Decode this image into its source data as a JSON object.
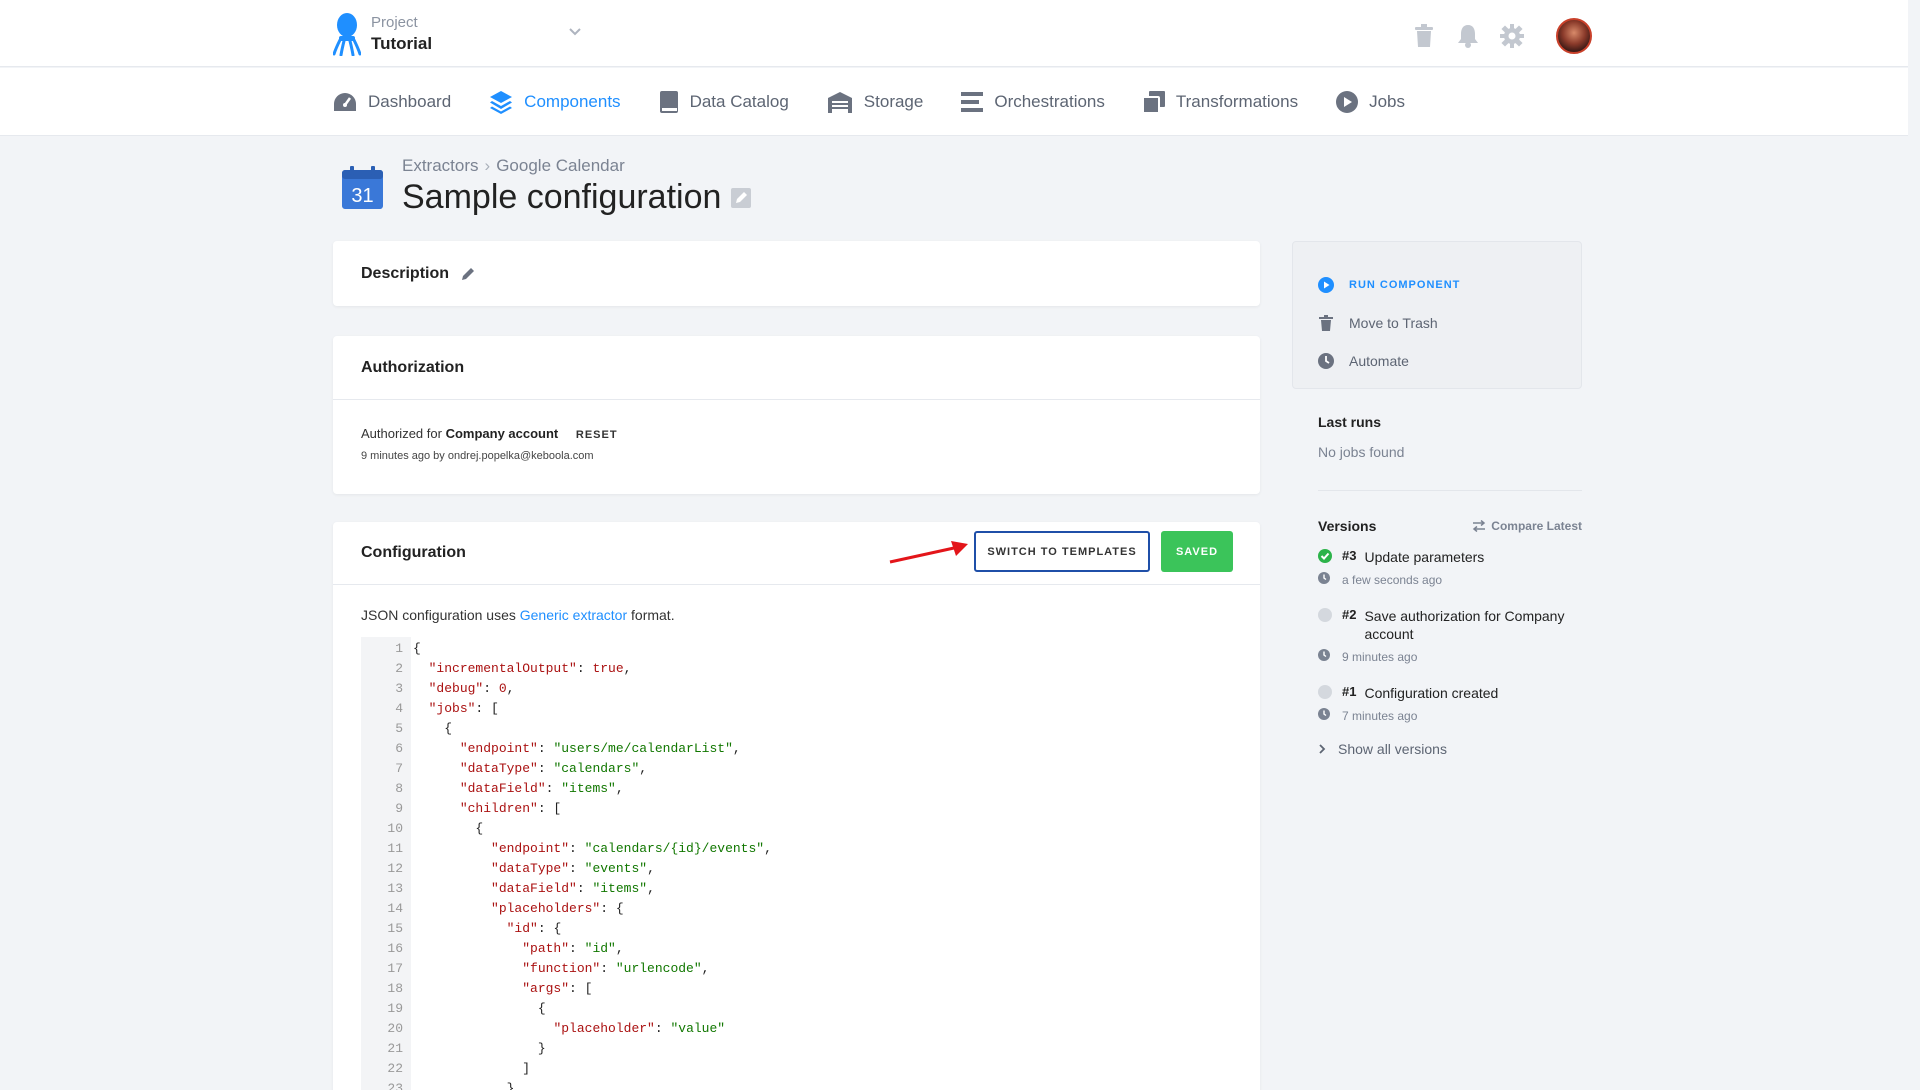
{
  "project": {
    "label": "Project",
    "name": "Tutorial"
  },
  "nav": [
    {
      "label": "Dashboard",
      "icon": "dashboard-icon",
      "active": false
    },
    {
      "label": "Components",
      "icon": "layers-icon",
      "active": true
    },
    {
      "label": "Data Catalog",
      "icon": "book-icon",
      "active": false
    },
    {
      "label": "Storage",
      "icon": "warehouse-icon",
      "active": false
    },
    {
      "label": "Orchestrations",
      "icon": "bars-icon",
      "active": false
    },
    {
      "label": "Transformations",
      "icon": "copy-icon",
      "active": false
    },
    {
      "label": "Jobs",
      "icon": "play-circle-icon",
      "active": false
    }
  ],
  "breadcrumb": {
    "parent": "Extractors",
    "separator": "›",
    "current": "Google Calendar",
    "calendar_day": "31"
  },
  "title": "Sample configuration",
  "description": {
    "heading": "Description"
  },
  "authorization": {
    "heading": "Authorization",
    "prefix": "Authorized for",
    "account": "Company account",
    "reset_label": "RESET",
    "meta": "9 minutes ago by ondrej.popelka@keboola.com"
  },
  "configuration": {
    "heading": "Configuration",
    "switch_label": "SWITCH TO TEMPLATES",
    "saved_label": "SAVED",
    "note_prefix": "JSON configuration uses",
    "note_link": "Generic extractor",
    "note_suffix": "format."
  },
  "code_lines": [
    [
      {
        "t": "{",
        "c": ""
      }
    ],
    [
      {
        "t": "  ",
        "c": ""
      },
      {
        "t": "\"incrementalOutput\"",
        "c": "k"
      },
      {
        "t": ": ",
        "c": ""
      },
      {
        "t": "true",
        "c": "kw"
      },
      {
        "t": ",",
        "c": ""
      }
    ],
    [
      {
        "t": "  ",
        "c": ""
      },
      {
        "t": "\"debug\"",
        "c": "k"
      },
      {
        "t": ": ",
        "c": ""
      },
      {
        "t": "0",
        "c": "n"
      },
      {
        "t": ",",
        "c": ""
      }
    ],
    [
      {
        "t": "  ",
        "c": ""
      },
      {
        "t": "\"jobs\"",
        "c": "k"
      },
      {
        "t": ": [",
        "c": ""
      }
    ],
    [
      {
        "t": "    {",
        "c": ""
      }
    ],
    [
      {
        "t": "      ",
        "c": ""
      },
      {
        "t": "\"endpoint\"",
        "c": "k"
      },
      {
        "t": ": ",
        "c": ""
      },
      {
        "t": "\"users/me/calendarList\"",
        "c": "s"
      },
      {
        "t": ",",
        "c": ""
      }
    ],
    [
      {
        "t": "      ",
        "c": ""
      },
      {
        "t": "\"dataType\"",
        "c": "k"
      },
      {
        "t": ": ",
        "c": ""
      },
      {
        "t": "\"calendars\"",
        "c": "s"
      },
      {
        "t": ",",
        "c": ""
      }
    ],
    [
      {
        "t": "      ",
        "c": ""
      },
      {
        "t": "\"dataField\"",
        "c": "k"
      },
      {
        "t": ": ",
        "c": ""
      },
      {
        "t": "\"items\"",
        "c": "s"
      },
      {
        "t": ",",
        "c": ""
      }
    ],
    [
      {
        "t": "      ",
        "c": ""
      },
      {
        "t": "\"children\"",
        "c": "k"
      },
      {
        "t": ": [",
        "c": ""
      }
    ],
    [
      {
        "t": "        {",
        "c": ""
      }
    ],
    [
      {
        "t": "          ",
        "c": ""
      },
      {
        "t": "\"endpoint\"",
        "c": "k"
      },
      {
        "t": ": ",
        "c": ""
      },
      {
        "t": "\"calendars/{id}/events\"",
        "c": "s"
      },
      {
        "t": ",",
        "c": ""
      }
    ],
    [
      {
        "t": "          ",
        "c": ""
      },
      {
        "t": "\"dataType\"",
        "c": "k"
      },
      {
        "t": ": ",
        "c": ""
      },
      {
        "t": "\"events\"",
        "c": "s"
      },
      {
        "t": ",",
        "c": ""
      }
    ],
    [
      {
        "t": "          ",
        "c": ""
      },
      {
        "t": "\"dataField\"",
        "c": "k"
      },
      {
        "t": ": ",
        "c": ""
      },
      {
        "t": "\"items\"",
        "c": "s"
      },
      {
        "t": ",",
        "c": ""
      }
    ],
    [
      {
        "t": "          ",
        "c": ""
      },
      {
        "t": "\"placeholders\"",
        "c": "k"
      },
      {
        "t": ": {",
        "c": ""
      }
    ],
    [
      {
        "t": "            ",
        "c": ""
      },
      {
        "t": "\"id\"",
        "c": "k"
      },
      {
        "t": ": {",
        "c": ""
      }
    ],
    [
      {
        "t": "              ",
        "c": ""
      },
      {
        "t": "\"path\"",
        "c": "k"
      },
      {
        "t": ": ",
        "c": ""
      },
      {
        "t": "\"id\"",
        "c": "s"
      },
      {
        "t": ",",
        "c": ""
      }
    ],
    [
      {
        "t": "              ",
        "c": ""
      },
      {
        "t": "\"function\"",
        "c": "k"
      },
      {
        "t": ": ",
        "c": ""
      },
      {
        "t": "\"urlencode\"",
        "c": "s"
      },
      {
        "t": ",",
        "c": ""
      }
    ],
    [
      {
        "t": "              ",
        "c": ""
      },
      {
        "t": "\"args\"",
        "c": "k"
      },
      {
        "t": ": [",
        "c": ""
      }
    ],
    [
      {
        "t": "                {",
        "c": ""
      }
    ],
    [
      {
        "t": "                  ",
        "c": ""
      },
      {
        "t": "\"placeholder\"",
        "c": "k"
      },
      {
        "t": ": ",
        "c": ""
      },
      {
        "t": "\"value\"",
        "c": "s"
      }
    ],
    [
      {
        "t": "                }",
        "c": ""
      }
    ],
    [
      {
        "t": "              ]",
        "c": ""
      }
    ],
    [
      {
        "t": "            }",
        "c": ""
      }
    ]
  ],
  "sidebar": {
    "run_label": "RUN COMPONENT",
    "trash_label": "Move to Trash",
    "automate_label": "Automate",
    "last_runs_heading": "Last runs",
    "last_runs_empty": "No jobs found",
    "versions_heading": "Versions",
    "compare_label": "Compare Latest",
    "show_all_label": "Show all versions"
  },
  "versions": [
    {
      "num": "#3",
      "text": "Update parameters",
      "time": "a few seconds ago",
      "status": "current",
      "color": "#2cb34a"
    },
    {
      "num": "#2",
      "text": "Save authorization for Company account",
      "time": "9 minutes ago",
      "status": "previous",
      "color": "#d4d8de"
    },
    {
      "num": "#1",
      "text": "Configuration created",
      "time": "7 minutes ago",
      "status": "previous",
      "color": "#d4d8de"
    }
  ],
  "colors": {
    "accent": "#1f8fff",
    "saved": "#3bc45a",
    "arrow": "#e3151a",
    "switch_border": "#1f4fa8"
  }
}
